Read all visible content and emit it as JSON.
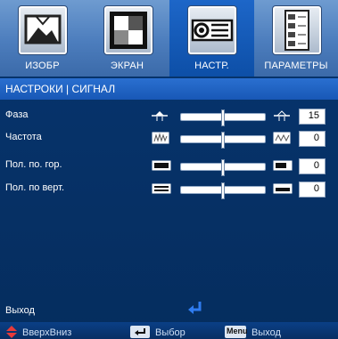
{
  "tabs": [
    {
      "label": "ИЗОБР",
      "icon": "picture-icon"
    },
    {
      "label": "ЭКРАН",
      "icon": "screen-icon"
    },
    {
      "label": "НАСТР.",
      "icon": "projector-icon",
      "active": true
    },
    {
      "label": "ПАРАМЕТРЫ",
      "icon": "options-icon"
    }
  ],
  "section_title": "НАСТРОКИ | СИГНАЛ",
  "settings": [
    {
      "label": "Фаза",
      "value": "15",
      "slider_level": 0.5,
      "icon": "phase-icon"
    },
    {
      "label": "Частота",
      "value": "0",
      "slider_level": 0.5,
      "icon": "frequency-icon"
    },
    {
      "label": "Пол. по. гор.",
      "value": "0",
      "slider_level": 0.5,
      "icon": "h-position-icon"
    },
    {
      "label": "Пол. по верт.",
      "value": "0",
      "slider_level": 0.5,
      "icon": "v-position-icon"
    }
  ],
  "exit_label": "Выход",
  "footer": {
    "updown": "ВверхВниз",
    "select": "Выбор",
    "menu_key": "Menu",
    "exit": "Выход"
  },
  "colors": {
    "accent": "#1d66c8",
    "background": "#07356f",
    "footer_arrow": "#e83a3a",
    "enter_arrow": "#2f7cf0"
  }
}
